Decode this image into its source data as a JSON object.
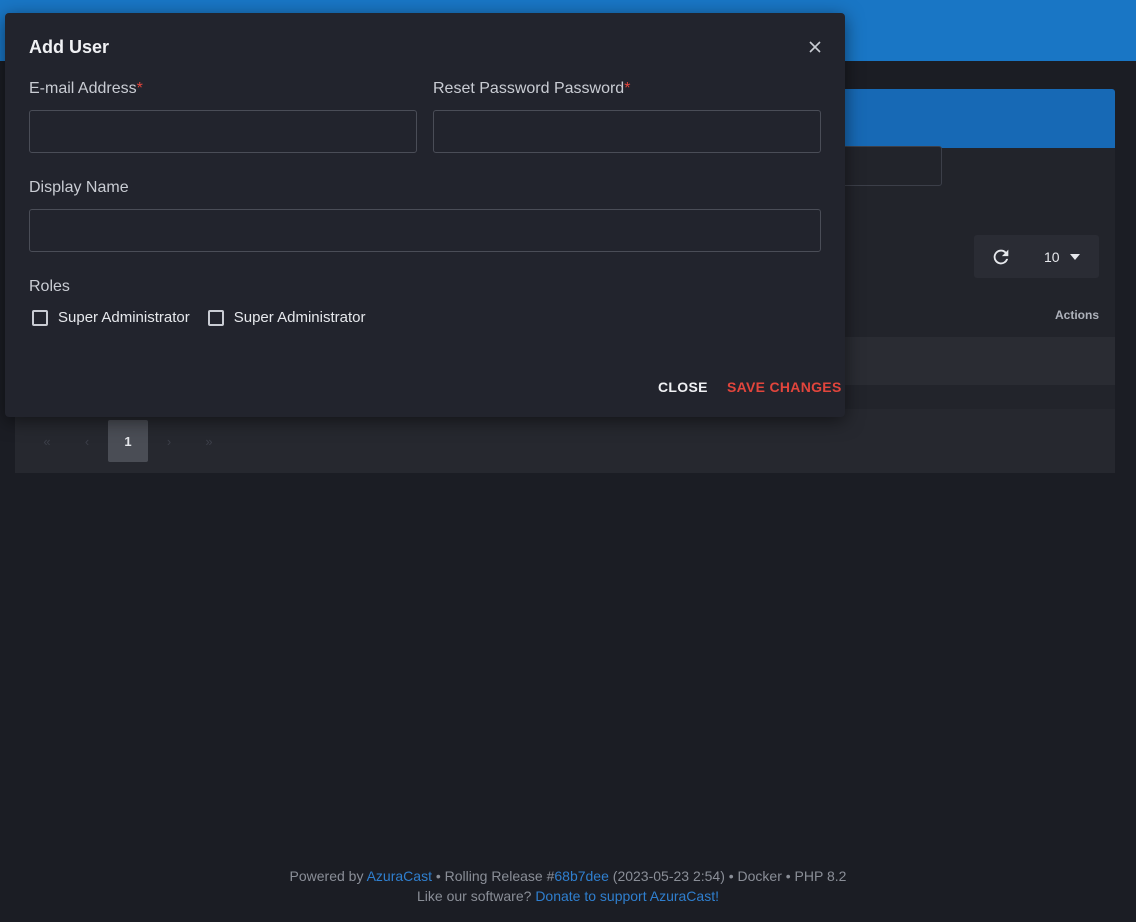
{
  "background": {
    "actions_header": "Actions",
    "per_page": "10",
    "pagination": {
      "first": "«",
      "prev": "‹",
      "current": "1",
      "next": "›",
      "last": "»"
    }
  },
  "modal": {
    "title": "Add User",
    "close_icon": "×",
    "email": {
      "label": "E-mail Address",
      "required": "*",
      "value": ""
    },
    "password": {
      "label": "Reset Password Password",
      "required": "*",
      "value": ""
    },
    "display_name": {
      "label": "Display Name",
      "value": ""
    },
    "roles": {
      "label": "Roles",
      "options": [
        "Super Administrator",
        "Super Administrator"
      ]
    },
    "buttons": {
      "close": "CLOSE",
      "save": "SAVE CHANGES"
    }
  },
  "footer": {
    "powered_by": "Powered by ",
    "azuracast_link": "AzuraCast",
    "release_prefix": " • Rolling Release #",
    "commit_link": "68b7dee",
    "release_suffix": " (2023-05-23 2:54) • Docker • PHP 8.2",
    "like_text": "Like our software? ",
    "donate_link": "Donate to support AzuraCast!"
  },
  "colors": {
    "accent": "#1976c5",
    "danger": "#e2453c",
    "link": "#2f7fcf"
  },
  "icons": {
    "refresh": "refresh-icon",
    "caret": "caret-down-icon",
    "close": "close-icon"
  }
}
